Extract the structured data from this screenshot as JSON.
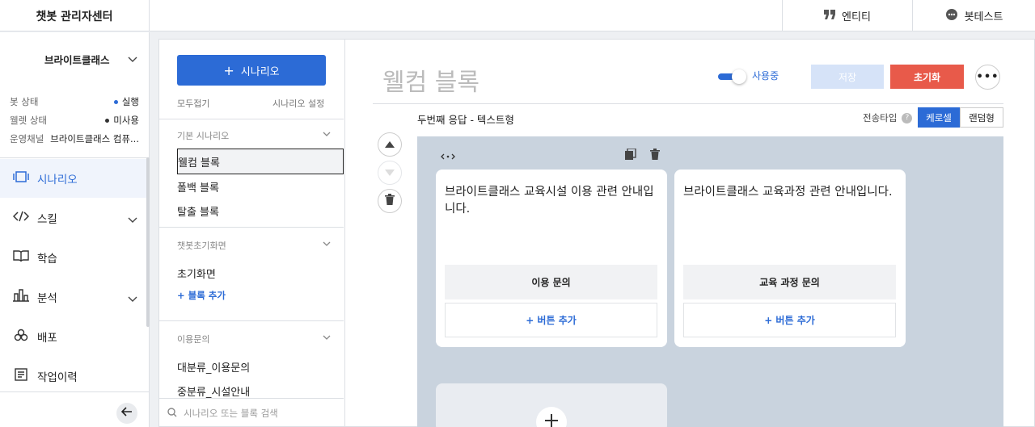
{
  "app": {
    "title": "챗봇 관리자센터"
  },
  "header": {
    "entity_label": "엔티티",
    "bottest_label": "봇테스트"
  },
  "sidebar": {
    "bot_name": "브라이트클래스",
    "status": [
      {
        "label": "봇 상태",
        "value": "실행",
        "dot_color": "#2c6bd6"
      },
      {
        "label": "웰렛 상태",
        "value": "미사용",
        "dot_color": "#333333"
      },
      {
        "label": "운영채널",
        "value": "브라이트클래스 컴퓨...",
        "dot_color": ""
      }
    ],
    "nav": [
      {
        "label": "시나리오",
        "icon": "scenario-icon",
        "active": true,
        "chevron": false
      },
      {
        "label": "스킬",
        "icon": "code-icon",
        "active": false,
        "chevron": true
      },
      {
        "label": "학습",
        "icon": "book-icon",
        "active": false,
        "chevron": false
      },
      {
        "label": "분석",
        "icon": "chart-icon",
        "active": false,
        "chevron": true
      },
      {
        "label": "배포",
        "icon": "deploy-icon",
        "active": false,
        "chevron": false
      },
      {
        "label": "작업이력",
        "icon": "history-icon",
        "active": false,
        "chevron": false
      }
    ]
  },
  "scenarios": {
    "add_label": "시나리오",
    "collapse_label": "모두접기",
    "settings_label": "시나리오 설정",
    "section1": {
      "title": "기본 시나리오",
      "items": [
        "웰컴 블록",
        "폴백 블록",
        "탈출 블록"
      ]
    },
    "section2": {
      "title": "챗봇초기화면",
      "items": [
        "초기화면"
      ],
      "add_label": "+ 블록 추가"
    },
    "section3": {
      "title": "이용문의",
      "items": [
        "대분류_이용문의",
        "중분류_시설안내"
      ]
    },
    "search_placeholder": "시나리오 또는 블록 검색"
  },
  "block": {
    "title": "웰컴 블록",
    "toggle_label": "사용중",
    "toggle_on": true,
    "save_label": "저장",
    "reset_label": "초기화",
    "more_label": "•••",
    "response_title": "두번째 응답 - 텍스트형",
    "send_type_label": "전송타입",
    "send_types": [
      "케로셀",
      "랜덤형"
    ],
    "selected_send_type": "케로셀",
    "cards": [
      {
        "text": "브라이트클래스 교육시설 이용 관련 안내입니다.",
        "button": "이용 문의",
        "add_button": "+ 버튼 추가"
      },
      {
        "text": "브라이트클래스 교육과정 관련 안내입니다.",
        "button": "교육 과정 문의",
        "add_button": "+ 버튼 추가"
      }
    ]
  },
  "colors": {
    "accent": "#2c6bd6",
    "danger": "#e85a4a",
    "canvas": "#c9d3de"
  }
}
